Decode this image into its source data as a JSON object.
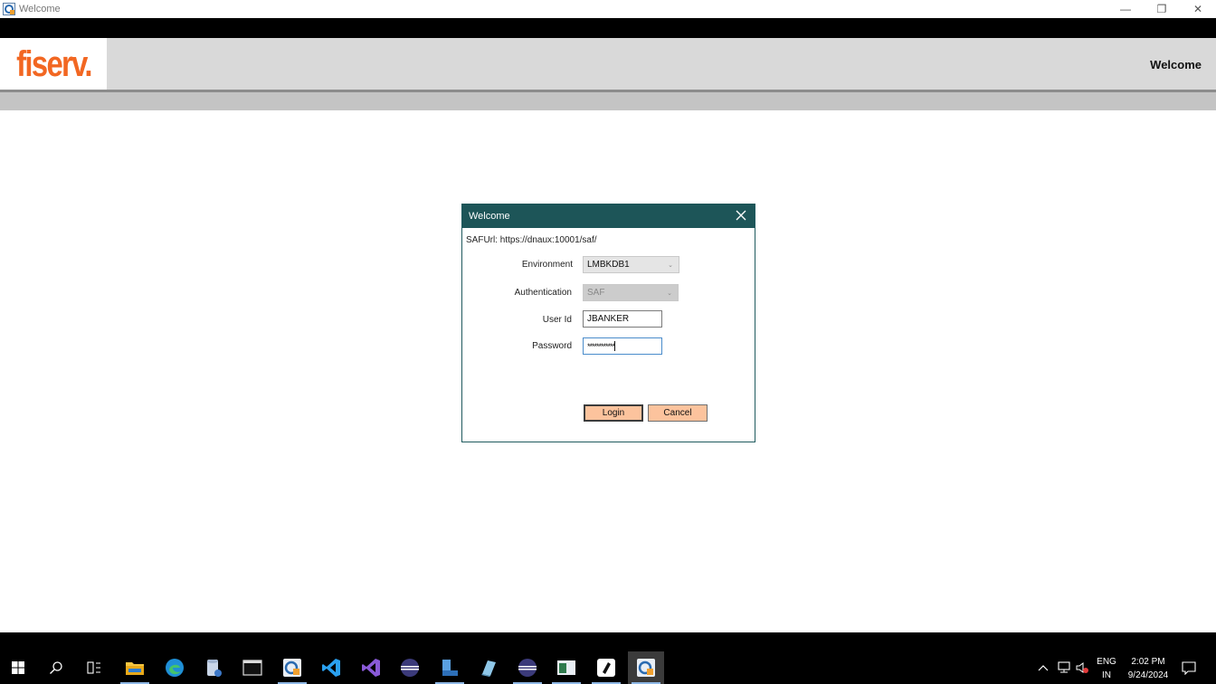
{
  "window": {
    "title": "Welcome",
    "minimize_glyph": "—",
    "restore_glyph": "❐",
    "close_glyph": "✕"
  },
  "header": {
    "logo_text": "fiserv.",
    "page_title": "Welcome",
    "brand_color": "#f26722"
  },
  "dialog": {
    "title": "Welcome",
    "saf_url": "SAFUrl: https://dnaux:10001/saf/",
    "environment": {
      "label": "Environment",
      "value": "LMBKDB1"
    },
    "authentication": {
      "label": "Authentication",
      "value": "SAF"
    },
    "user_id": {
      "label": "User Id",
      "value": "JBANKER"
    },
    "password": {
      "label": "Password",
      "value": "************"
    },
    "login_label": "Login",
    "cancel_label": "Cancel",
    "title_bg": "#1d5558",
    "button_bg": "#fcc39d"
  },
  "taskbar": {
    "items": [
      "start-icon",
      "search-icon",
      "task-view-icon",
      "file-explorer-icon",
      "edge-icon",
      "app-icon",
      "terminal-icon",
      "remote-app-icon",
      "vscode-icon",
      "visual-studio-icon",
      "eclipse-icon",
      "app-icon",
      "app-icon",
      "eclipse-icon",
      "app-icon",
      "app-icon",
      "active-app-icon"
    ],
    "lang_line1": "ENG",
    "lang_line2": "IN",
    "time": "2:02 PM",
    "date": "9/24/2024"
  }
}
